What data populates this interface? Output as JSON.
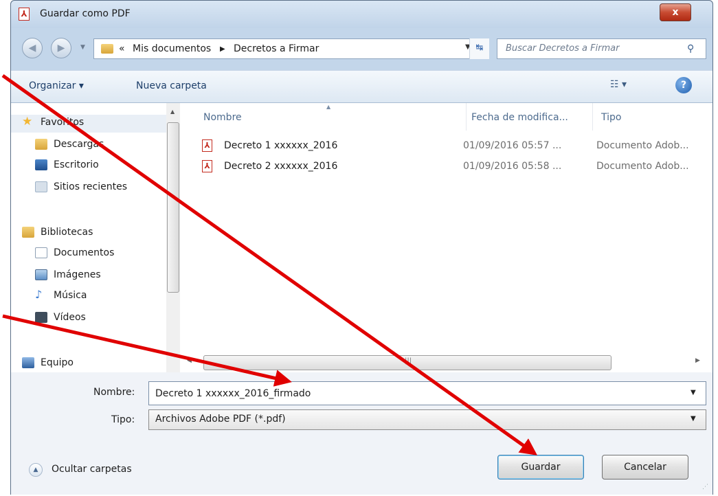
{
  "window": {
    "title": "Guardar como PDF",
    "close_label": "x"
  },
  "address": {
    "crumbs_prefix": "«",
    "crumbs": [
      "Mis documentos",
      "Decretos a Firmar"
    ],
    "separator": "▶",
    "search_placeholder": "Buscar Decretos a Firmar"
  },
  "toolbar": {
    "organize_label": "Organizar ▾",
    "new_folder_label": "Nueva carpeta",
    "help_label": "?"
  },
  "nav": {
    "items": [
      {
        "label": "Favoritos",
        "icon": "star-icon",
        "color": "#f2b632"
      },
      {
        "label": "Descargas",
        "icon": "downloads-folder-icon",
        "color": "#5b8fd2"
      },
      {
        "label": "Escritorio",
        "icon": "desktop-icon",
        "color": "#2f5f9e"
      },
      {
        "label": "Sitios recientes",
        "icon": "recent-places-icon",
        "color": "#9fb3c8"
      },
      {
        "label": "Bibliotecas",
        "icon": "libraries-icon",
        "color": "#e8c24b"
      },
      {
        "label": "Documentos",
        "icon": "documents-icon",
        "color": "#c9d3de"
      },
      {
        "label": "Imágenes",
        "icon": "pictures-icon",
        "color": "#6da0d8"
      },
      {
        "label": "Música",
        "icon": "music-icon",
        "color": "#3b7bd0"
      },
      {
        "label": "Vídeos",
        "icon": "videos-icon",
        "color": "#3f4d5c"
      },
      {
        "label": "Equipo",
        "icon": "computer-icon",
        "color": "#4e85c8"
      }
    ]
  },
  "files": {
    "columns": [
      "Nombre",
      "Fecha de modifica...",
      "Tipo"
    ],
    "rows": [
      {
        "name": "Decreto 1 xxxxxx_2016",
        "date": "01/09/2016 05:57 ...",
        "type": "Documento Adob..."
      },
      {
        "name": "Decreto 2 xxxxxx_2016",
        "date": "01/09/2016 05:58 ...",
        "type": "Documento Adob..."
      }
    ]
  },
  "form": {
    "name_label": "Nombre:",
    "name_value": "Decreto 1 xxxxxx_2016_firmado",
    "type_label": "Tipo:",
    "type_value": "Archivos Adobe PDF (*.pdf)"
  },
  "footer": {
    "hide_folders_label": "Ocultar carpetas",
    "save_label": "Guardar",
    "cancel_label": "Cancelar"
  },
  "colors": {
    "annotation_arrow": "#e00000",
    "pdf_red": "#c32a1e"
  }
}
